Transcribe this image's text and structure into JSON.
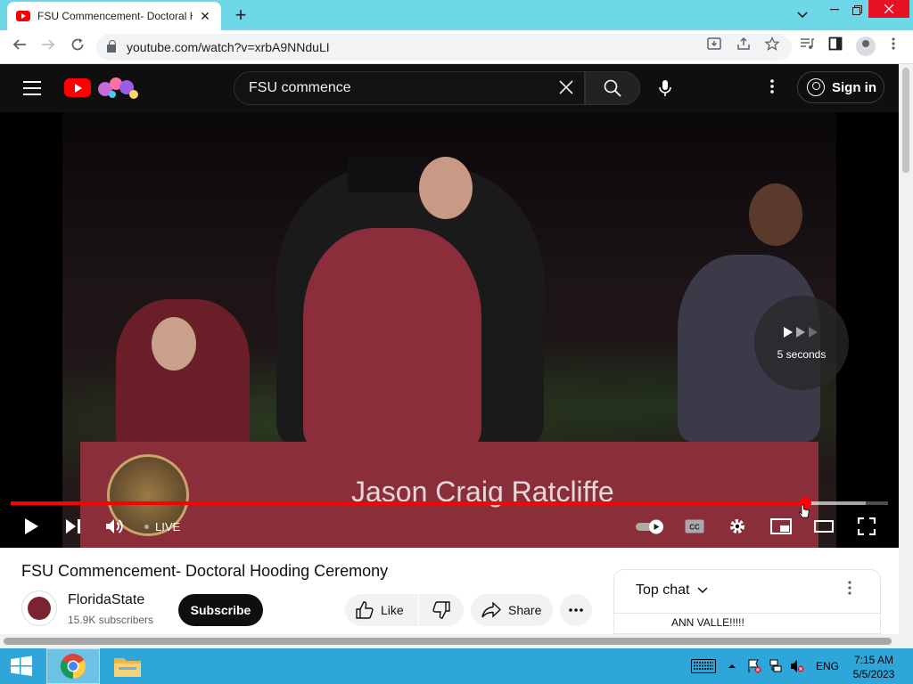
{
  "browser": {
    "tab_title": "FSU Commencement- Doctoral Hooding Ceremony - YouTube",
    "tab_close": "✕",
    "new_tab": "+",
    "url": "youtube.com/watch?v=xrbA9NNduLI"
  },
  "masthead": {
    "search_value": "FSU commence",
    "search_placeholder": "Search",
    "signin_label": "Sign in"
  },
  "player": {
    "banner_name": "Jason Craig Ratcliffe",
    "skip_text": "5 seconds",
    "live_label": "LIVE",
    "progress_played": 0.905,
    "progress_buffered": 0.975
  },
  "video": {
    "title": "FSU Commencement- Doctoral Hooding Ceremony",
    "channel_name": "FloridaState",
    "subscribers": "15.9K subscribers",
    "subscribe_label": "Subscribe",
    "like_label": "Like",
    "share_label": "Share"
  },
  "chat": {
    "header": "Top chat",
    "message": "ANN VALLE!!!!!"
  },
  "taskbar": {
    "language": "ENG",
    "time": "7:15 AM",
    "date": "5/5/2023"
  },
  "colors": {
    "accent_red": "#ff0000",
    "tabstrip": "#6fd8e8",
    "taskbar": "#2ea6d9"
  }
}
